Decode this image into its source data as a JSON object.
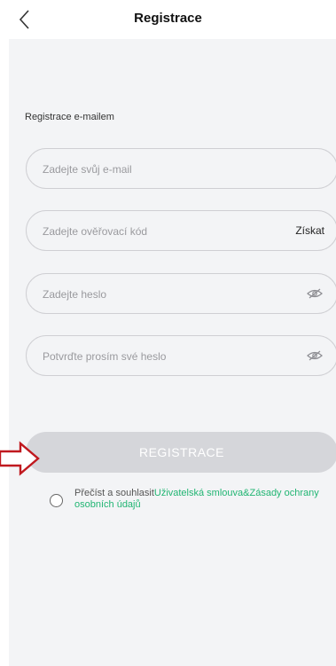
{
  "header": {
    "title": "Registrace"
  },
  "form": {
    "section_label": "Registrace e-mailem",
    "email_placeholder": "Zadejte svůj e-mail",
    "code_placeholder": "Zadejte ověřovací kód",
    "get_code_label": "Získat",
    "password_placeholder": "Zadejte heslo",
    "confirm_placeholder": "Potvrďte prosím své heslo",
    "submit_label": "REGISTRACE"
  },
  "agreement": {
    "prefix": "Přečíst a souhlasit",
    "user_agreement": "Uživatelská smlouva",
    "separator": "&",
    "privacy_policy": "Zásady ochrany osobních údajů"
  },
  "colors": {
    "accent": "#21b573",
    "annotation_arrow": "#c0191f",
    "disabled_button": "#d5d6da",
    "panel": "#f3f4f6"
  },
  "icons": {
    "back": "chevron-left-icon",
    "password_toggle": "eye-off-icon"
  }
}
